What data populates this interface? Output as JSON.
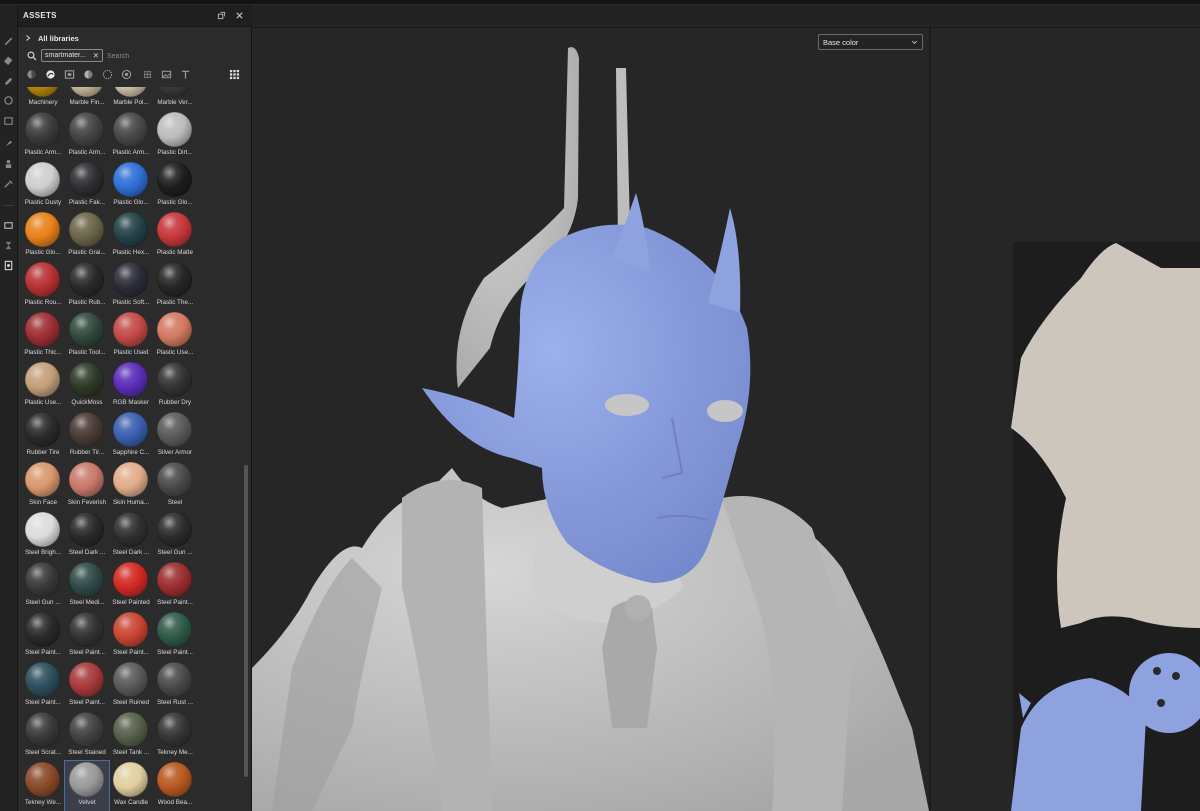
{
  "panel": {
    "title": "ASSETS",
    "library": "All libraries",
    "search": {
      "filter_chip": "smartmater...",
      "placeholder": "Search"
    }
  },
  "toolbar_icons": [
    "brush-icon",
    "eraser-icon",
    "projection-icon",
    "geometry-mask-icon",
    "polygon-fill-icon",
    "smudge-icon",
    "clone-icon",
    "picker-icon",
    "bake-icon",
    "history-icon",
    "layers-icon"
  ],
  "filter_icons": [
    "materials-icon",
    "smart-materials-icon",
    "textures-icon",
    "brushes-icon",
    "particles-icon",
    "procedurals-icon",
    "environments-icon",
    "fonts-icon",
    "view-mode-icon"
  ],
  "materials": [
    {
      "label": "Machinery",
      "color": "#b8860b"
    },
    {
      "label": "Marble Fin...",
      "color": "#c8b79a"
    },
    {
      "label": "Marble Pol...",
      "color": "#cfc2a8"
    },
    {
      "label": "Marble Ver...",
      "color": "#3a3a3a"
    },
    {
      "label": "Plastic Arm...",
      "color": "#3c3c3c"
    },
    {
      "label": "Plastic Arm...",
      "color": "#444444"
    },
    {
      "label": "Plastic Arm...",
      "color": "#484848"
    },
    {
      "label": "Plastic Dirt...",
      "color": "#bdbdbd"
    },
    {
      "label": "Plastic Dusty",
      "color": "#cfcfcf"
    },
    {
      "label": "Plastic Fak...",
      "color": "#2e2e33"
    },
    {
      "label": "Plastic Glo...",
      "color": "#2f6fd6"
    },
    {
      "label": "Plastic Glo...",
      "color": "#1e1e1e"
    },
    {
      "label": "Plastic Glo...",
      "color": "#e8821a"
    },
    {
      "label": "Plastic Grai...",
      "color": "#6b6548"
    },
    {
      "label": "Plastic Hex...",
      "color": "#234248"
    },
    {
      "label": "Plastic Matte",
      "color": "#c8373a"
    },
    {
      "label": "Plastic Rou...",
      "color": "#b83234"
    },
    {
      "label": "Plastic Rub...",
      "color": "#2a2a2a"
    },
    {
      "label": "Plastic Soft...",
      "color": "#2d2d3a"
    },
    {
      "label": "Plastic The...",
      "color": "#262626"
    },
    {
      "label": "Plastic Thic...",
      "color": "#9c2f34"
    },
    {
      "label": "Plastic Tool...",
      "color": "#2f4a3c"
    },
    {
      "label": "Plastic Used",
      "color": "#c24a48"
    },
    {
      "label": "Plastic Use...",
      "color": "#d47a62"
    },
    {
      "label": "Plastic Use...",
      "color": "#c4a07a"
    },
    {
      "label": "QuickMoss",
      "color": "#2e3a26"
    },
    {
      "label": "RGB Masker",
      "color": "#5a2db8"
    },
    {
      "label": "Rubber Dry",
      "color": "#333333"
    },
    {
      "label": "Rubber Tire",
      "color": "#2b2b2b"
    },
    {
      "label": "Rubber Tir...",
      "color": "#4a3a34"
    },
    {
      "label": "Sapphire C...",
      "color": "#3a5fb0"
    },
    {
      "label": "Silver Armor",
      "color": "#5a5a5a"
    },
    {
      "label": "Skin Face",
      "color": "#d9986e"
    },
    {
      "label": "Skin Feverish",
      "color": "#c87a6a"
    },
    {
      "label": "Skin Huma...",
      "color": "#e1ad8b"
    },
    {
      "label": "Steel",
      "color": "#4a4a4a"
    },
    {
      "label": "Steel Brigh...",
      "color": "#dcdcdc"
    },
    {
      "label": "Steel Dark ...",
      "color": "#2a2a2a"
    },
    {
      "label": "Steel Dark ...",
      "color": "#303030"
    },
    {
      "label": "Steel Gun ...",
      "color": "#2c2c2c"
    },
    {
      "label": "Steel Gun ...",
      "color": "#3a3a3a"
    },
    {
      "label": "Steel Medi...",
      "color": "#2f4a48"
    },
    {
      "label": "Steel Painted",
      "color": "#d22a24"
    },
    {
      "label": "Steel Paint...",
      "color": "#9c2e30"
    },
    {
      "label": "Steel Paint...",
      "color": "#2a2a2a"
    },
    {
      "label": "Steel Paint...",
      "color": "#333333"
    },
    {
      "label": "Steel Paint...",
      "color": "#c94532"
    },
    {
      "label": "Steel Paint...",
      "color": "#2f5a48"
    },
    {
      "label": "Steel Paint...",
      "color": "#2c4f5e"
    },
    {
      "label": "Steel Paint...",
      "color": "#a83a3a"
    },
    {
      "label": "Steel Ruined",
      "color": "#5a5a5a"
    },
    {
      "label": "Steel Rust ...",
      "color": "#4a4a4a"
    },
    {
      "label": "Steel Scrat...",
      "color": "#3a3a3a"
    },
    {
      "label": "Steel Stained",
      "color": "#424242"
    },
    {
      "label": "Steel Tank ...",
      "color": "#56604a"
    },
    {
      "label": "Tekney Me...",
      "color": "#353535"
    },
    {
      "label": "Tekney We...",
      "color": "#8a4a2a"
    },
    {
      "label": "Velvet",
      "color": "#9a9a9a"
    },
    {
      "label": "Wax Candle",
      "color": "#e0cfa0"
    },
    {
      "label": "Wood Bea...",
      "color": "#b85a22"
    }
  ],
  "selected_material": "Velvet",
  "viewport": {
    "channel": "Base color"
  },
  "colors": {
    "panel_bg": "#2b2b2b",
    "viewport_bg": "#262626",
    "mesh_gray": "#c4c4c4",
    "mesh_blue": "#8fa2e0",
    "uv_beige": "#ccc6bc"
  }
}
